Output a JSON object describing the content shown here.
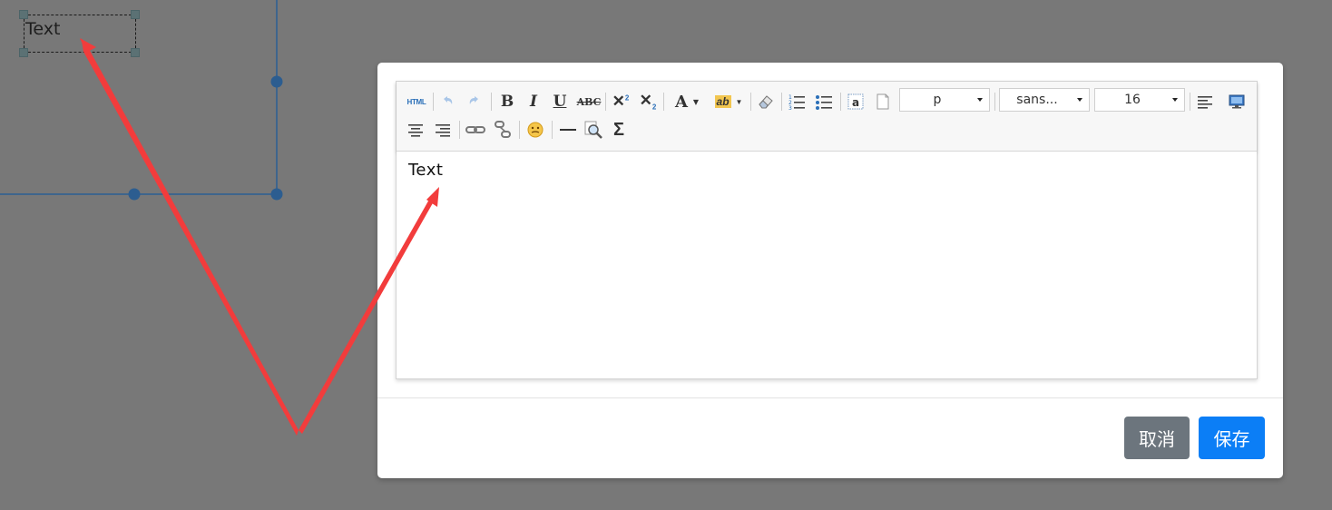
{
  "canvas": {
    "text_element": "Text"
  },
  "toolbar": {
    "items": [
      {
        "name": "html-source-button",
        "icon": "html-icon",
        "glyph": "HTML"
      },
      {
        "name": "undo-button",
        "icon": "undo-icon",
        "glyph": "↶"
      },
      {
        "name": "redo-button",
        "icon": "redo-icon",
        "glyph": "↷"
      },
      {
        "name": "bold-button",
        "icon": "bold-icon",
        "glyph": "B"
      },
      {
        "name": "italic-button",
        "icon": "italic-icon",
        "glyph": "I"
      },
      {
        "name": "underline-button",
        "icon": "underline-icon",
        "glyph": "U"
      },
      {
        "name": "strikethrough-button",
        "icon": "strikethrough-icon",
        "glyph": "ABC"
      },
      {
        "name": "superscript-button",
        "icon": "superscript-icon",
        "glyph": "X²"
      },
      {
        "name": "subscript-button",
        "icon": "subscript-icon",
        "glyph": "X₂"
      },
      {
        "name": "font-color-button",
        "icon": "font-color-icon",
        "glyph": "A"
      },
      {
        "name": "highlight-button",
        "icon": "highlight-icon",
        "glyph": "ab"
      },
      {
        "name": "clear-format-button",
        "icon": "eraser-icon",
        "glyph": "⌫"
      },
      {
        "name": "ordered-list-button",
        "icon": "ordered-list-icon",
        "glyph": "≡"
      },
      {
        "name": "unordered-list-button",
        "icon": "unordered-list-icon",
        "glyph": "≡"
      },
      {
        "name": "paste-text-button",
        "icon": "paste-text-icon",
        "glyph": "a"
      },
      {
        "name": "blank-page-button",
        "icon": "page-icon",
        "glyph": ""
      },
      {
        "name": "align-left-button",
        "icon": "align-left-icon",
        "glyph": "≡"
      },
      {
        "name": "fullscreen-button",
        "icon": "monitor-icon",
        "glyph": ""
      },
      {
        "name": "align-center-button",
        "icon": "align-center-icon",
        "glyph": "≡"
      },
      {
        "name": "align-right-button",
        "icon": "align-right-icon",
        "glyph": "≡"
      },
      {
        "name": "link-button",
        "icon": "link-icon",
        "glyph": "∞"
      },
      {
        "name": "unlink-button",
        "icon": "unlink-icon",
        "glyph": "∞"
      },
      {
        "name": "emoji-button",
        "icon": "emoji-icon",
        "glyph": "☺"
      },
      {
        "name": "horizontal-rule-button",
        "icon": "horizontal-rule-icon",
        "glyph": "—"
      },
      {
        "name": "search-replace-button",
        "icon": "search-icon",
        "glyph": "⌕"
      },
      {
        "name": "formula-button",
        "icon": "sigma-icon",
        "glyph": "Σ"
      }
    ],
    "paragraph_select": "p",
    "font_family_select": "sans...",
    "font_size_select": "16"
  },
  "editor": {
    "content": "Text"
  },
  "footer": {
    "cancel_label": "取消",
    "save_label": "保存"
  },
  "colors": {
    "overlay": "#787878",
    "primary": "#0b7ef6",
    "secondary": "#6c757d",
    "annotation_arrow": "#f23c3c",
    "selection_line": "#2b5f94"
  }
}
